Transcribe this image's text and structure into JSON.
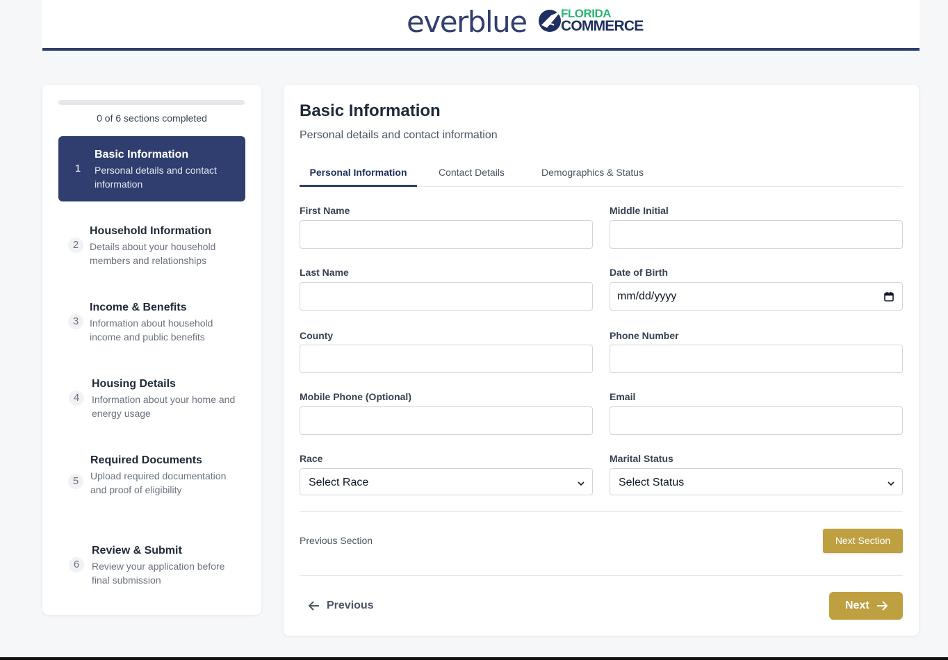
{
  "header": {
    "brand": "everblue",
    "partner_top": "FLORIDA",
    "partner_bottom": "COMMERCE"
  },
  "sidebar": {
    "progress_fraction": 0,
    "progress_text": "0 of 6 sections completed",
    "steps": [
      {
        "number": "1",
        "title": "Basic Information",
        "description": "Personal details and contact information"
      },
      {
        "number": "2",
        "title": "Household Information",
        "description": "Details about your household members and relationships"
      },
      {
        "number": "3",
        "title": "Income & Benefits",
        "description": "Information about household income and public benefits"
      },
      {
        "number": "4",
        "title": "Housing Details",
        "description": "Information about your home and energy usage"
      },
      {
        "number": "5",
        "title": "Required Documents",
        "description": "Upload required documentation and proof of eligibility"
      },
      {
        "number": "6",
        "title": "Review & Submit",
        "description": "Review your application before final submission"
      }
    ]
  },
  "main": {
    "title": "Basic Information",
    "subtitle": "Personal details and contact information",
    "tabs": [
      {
        "label": "Personal Information"
      },
      {
        "label": "Contact Details"
      },
      {
        "label": "Demographics & Status"
      }
    ],
    "fields": {
      "first_name": {
        "label": "First Name",
        "value": ""
      },
      "middle_initial": {
        "label": "Middle Initial",
        "value": ""
      },
      "last_name": {
        "label": "Last Name",
        "value": ""
      },
      "date_of_birth": {
        "label": "Date of Birth",
        "value": "mm/dd/yyyy"
      },
      "county": {
        "label": "County",
        "value": ""
      },
      "phone_number": {
        "label": "Phone Number",
        "value": ""
      },
      "mobile_phone": {
        "label": "Mobile Phone (Optional)",
        "value": ""
      },
      "email": {
        "label": "Email",
        "value": ""
      },
      "race": {
        "label": "Race",
        "value": "Select Race"
      },
      "marital_status": {
        "label": "Marital Status",
        "value": "Select Status"
      }
    },
    "previous_section_label": "Previous Section",
    "next_section_label": "Next Section",
    "previous_label": "Previous",
    "next_label": "Next"
  },
  "colors": {
    "navy": "#2f3e6e",
    "gold": "#bfa041",
    "green": "#2bb673"
  }
}
